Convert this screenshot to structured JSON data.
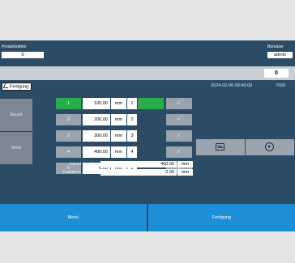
{
  "header": {
    "counter_label": "Produktzähler",
    "counter_value": "0",
    "user_label": "Benutzer",
    "user_value": "admin",
    "band_value": "0"
  },
  "tab": {
    "label": "Fertigung",
    "datetime": "2024-02-06 09:49:00",
    "code": "7000"
  },
  "side_buttons": [
    "Einzel",
    "Serie"
  ],
  "positions": [
    {
      "num": "1",
      "value": "100.00",
      "unit": "mm",
      "idx": "1",
      "active": true
    },
    {
      "num": "2",
      "value": "200.00",
      "unit": "mm",
      "idx": "2",
      "active": false
    },
    {
      "num": "3",
      "value": "300.00",
      "unit": "mm",
      "idx": "3",
      "active": false
    },
    {
      "num": "4",
      "value": "400.00",
      "unit": "mm",
      "idx": "4",
      "active": false
    },
    {
      "num": "5",
      "value": "0.00",
      "unit": "mm",
      "idx": "0",
      "active": false
    }
  ],
  "delete_icon": "close-x-icon",
  "function_icons": [
    "swap-icon",
    "stop-circle-icon"
  ],
  "fields": {
    "istwert_label": "Istwert Anschlag",
    "istwert_value": "400.00",
    "istwert_unit": "mm",
    "freifahren_label": "Freifahren Anschlag",
    "freifahren_value": "2.00",
    "freifahren_unit": "mm"
  },
  "nav": {
    "menu": "Menü",
    "fertigung": "Fertigung"
  },
  "colors": {
    "background": "#2c4c66",
    "active_green": "#27ad4b",
    "nav_blue": "#1e8fd6"
  }
}
